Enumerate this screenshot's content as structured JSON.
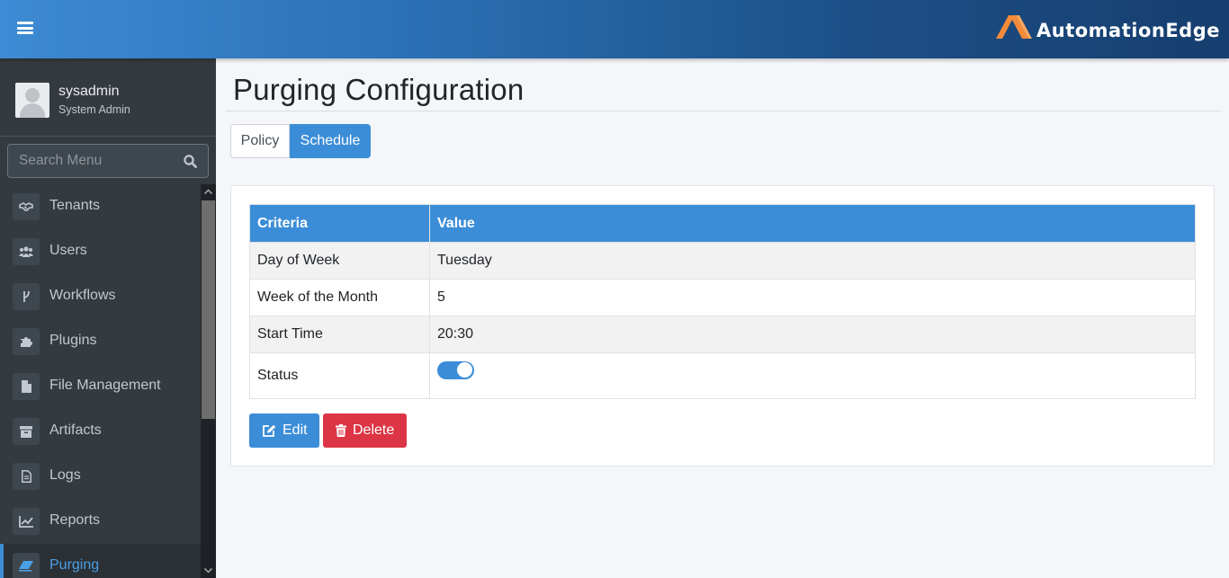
{
  "header": {
    "menu_icon": "hamburger-icon",
    "logo_text": "AutomationEdge",
    "logo_color": "#f58a3a"
  },
  "user": {
    "name": "sysadmin",
    "role": "System Admin"
  },
  "search": {
    "placeholder": "Search Menu",
    "icon": "search-icon"
  },
  "menu": {
    "items": [
      {
        "label": "Tenants",
        "icon": "handshake-icon"
      },
      {
        "label": "Users",
        "icon": "users-icon"
      },
      {
        "label": "Workflows",
        "icon": "branch-icon"
      },
      {
        "label": "Plugins",
        "icon": "puzzle-icon"
      },
      {
        "label": "File Management",
        "icon": "file-icon"
      },
      {
        "label": "Artifacts",
        "icon": "archive-icon"
      },
      {
        "label": "Logs",
        "icon": "log-icon"
      },
      {
        "label": "Reports",
        "icon": "chart-line-icon"
      },
      {
        "label": "Purging",
        "icon": "eraser-icon",
        "active": true
      }
    ]
  },
  "page": {
    "title": "Purging Configuration",
    "tabs": [
      {
        "label": "Policy",
        "active": false
      },
      {
        "label": "Schedule",
        "active": true
      }
    ]
  },
  "table": {
    "headers": [
      "Criteria",
      "Value"
    ],
    "rows": [
      {
        "criteria": "Day of Week",
        "value": "Tuesday"
      },
      {
        "criteria": "Week of the Month",
        "value": "5"
      },
      {
        "criteria": "Start Time",
        "value": "20:30"
      },
      {
        "criteria": "Status",
        "value_toggle": true
      }
    ]
  },
  "actions": {
    "edit_label": "Edit",
    "delete_label": "Delete"
  },
  "colors": {
    "accent": "#3c8dd7",
    "danger": "#dc3545",
    "sidebar": "#343a40"
  }
}
